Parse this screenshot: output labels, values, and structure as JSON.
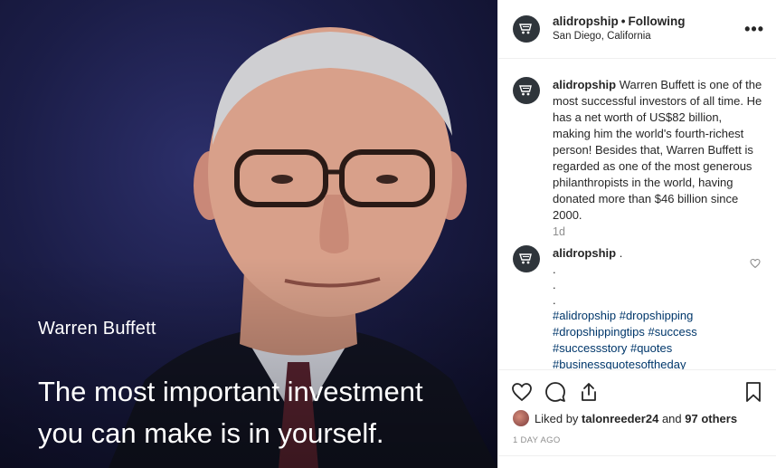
{
  "photo": {
    "name": "Warren Buffett",
    "quote_line1": "The most important investment",
    "quote_line2": "you can make is in yourself."
  },
  "header": {
    "username": "alidropship",
    "separator": "•",
    "follow_status": "Following",
    "location": "San Diego, California",
    "more_icon": "more-options-icon"
  },
  "caption": {
    "username": "alidropship",
    "text": "Warren Buffett is one of the most successful investors of all time. He has a net worth of US$82 billion, making him the world's fourth-richest person! Besides that, Warren Buffett is regarded as one of the most generous philanthropists in the world, having donated more than $46 billion since 2000.",
    "time": "1d"
  },
  "comment": {
    "username": "alidropship",
    "first": ".",
    "dots": [
      ".",
      ".",
      "."
    ],
    "hashtags": [
      "#alidropship #dropshipping",
      "#dropshippingtips #success",
      "#successstory #quotes",
      "#businessquotesoftheday"
    ]
  },
  "likes": {
    "prefix": "Liked by",
    "user": "talonreeder24",
    "joiner": "and",
    "others": "97 others"
  },
  "post_date": "1 DAY AGO",
  "icons": [
    "heart-icon",
    "comment-icon",
    "share-icon",
    "bookmark-icon",
    "cart-logo-icon"
  ]
}
